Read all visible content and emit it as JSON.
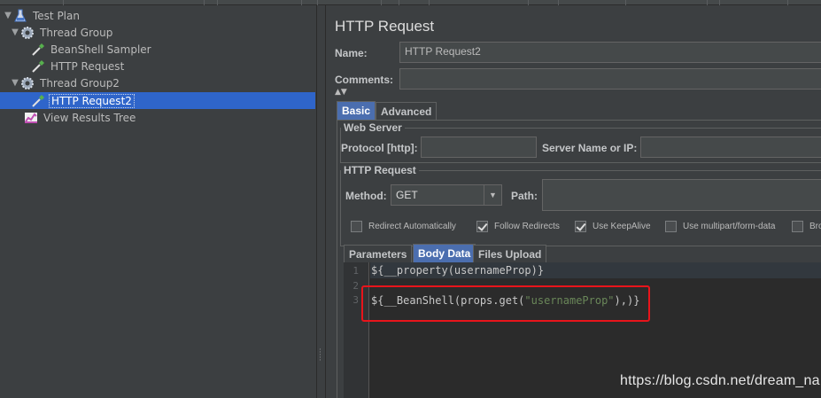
{
  "tree": {
    "items": [
      {
        "label": "Test Plan",
        "icon": "test-plan-flask-icon",
        "expanded": true
      },
      {
        "label": "Thread Group",
        "icon": "gear-icon",
        "expanded": true
      },
      {
        "label": "BeanShell Sampler",
        "icon": "pipette-icon"
      },
      {
        "label": "HTTP Request",
        "icon": "pipette-icon"
      },
      {
        "label": "Thread Group2",
        "icon": "gear-icon",
        "expanded": true
      },
      {
        "label": "HTTP Request2",
        "icon": "pipette-icon",
        "selected": true
      },
      {
        "label": "View Results Tree",
        "icon": "graph-icon"
      }
    ]
  },
  "form": {
    "title": "HTTP Request",
    "name_label": "Name:",
    "name_value": "HTTP Request2",
    "comments_label": "Comments:",
    "comments_value": "",
    "tabs": [
      {
        "label": "Basic",
        "active": true
      },
      {
        "label": "Advanced",
        "active": false
      }
    ],
    "web_server": {
      "title": "Web Server",
      "protocol_label": "Protocol [http]:",
      "protocol_value": "",
      "server_label": "Server Name or IP:",
      "server_value": ""
    },
    "http_request": {
      "title": "HTTP Request",
      "method_label": "Method:",
      "method_value": "GET",
      "path_label": "Path:",
      "path_value": ""
    },
    "options": [
      {
        "label": "Redirect Automatically",
        "checked": false
      },
      {
        "label": "Follow Redirects",
        "checked": true
      },
      {
        "label": "Use KeepAlive",
        "checked": true
      },
      {
        "label": "Use multipart/form-data",
        "checked": false
      },
      {
        "label": "Bro",
        "checked": false
      }
    ],
    "body_tabs": [
      {
        "label": "Parameters",
        "active": false
      },
      {
        "label": "Body Data",
        "active": true
      },
      {
        "label": "Files Upload",
        "active": false
      }
    ],
    "editor": {
      "lines": [
        {
          "no": "1",
          "text": "${__property(usernameProp)}"
        },
        {
          "no": "2",
          "text": ""
        },
        {
          "no": "3",
          "prefix": "${__BeanShell(props.get(",
          "string": "\"usernameProp\"",
          "suffix": "),)}"
        }
      ]
    }
  },
  "watermark": "https://blog.csdn.net/dream_na",
  "colors": {
    "background": "#3c3f41",
    "selection": "#2f65ca",
    "active_tab": "#4b6eaf",
    "editor_bg": "#2b2b2b",
    "string_literal": "#6a8759",
    "annotation_box": "#e8141b"
  }
}
